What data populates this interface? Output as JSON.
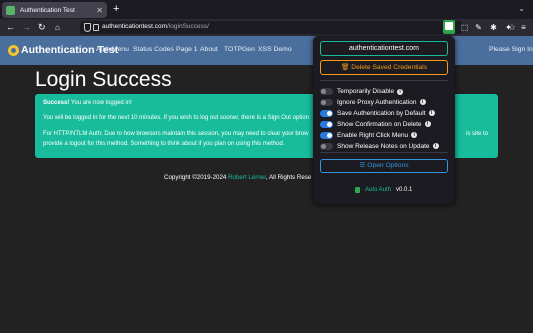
{
  "browser": {
    "tab_title": "Authentication Test",
    "new_tab_glyph": "+",
    "url_host": "authenticationtest.com",
    "url_path": "/loginSuccess/"
  },
  "site": {
    "brand": "Authentication Test",
    "nav": [
      "Auth Menu",
      "Status Codes",
      "Page 1",
      "About",
      "TOTPGen",
      "XSS Demo"
    ],
    "sign_in": "Please Sign In",
    "heading": "Login Success",
    "alert": {
      "bold": "Success!",
      "line1": " You are now logged in!",
      "line2": "You will be logged in for the next 10 minutes. If you wish to log out sooner, there is a Sign Out option",
      "line3": "For HTTP/NTLM Auth: Due to how browsers maintain this session, you may need to clear your brow",
      "line3_tail": "is site to",
      "line4": "provide a logout for this method. Something to think about if you plan on using this method."
    },
    "copyright_prefix": "Copyright ©2019-2024 ",
    "copyright_author": "Robert Lerner",
    "copyright_suffix": ", All Rights Rese"
  },
  "popup": {
    "domain": "authenticationtest.com",
    "delete_label": "Delete Saved Credentials",
    "toggles": [
      {
        "label": "Temporarily Disable",
        "on": false
      },
      {
        "label": "Ignore Proxy Authentication",
        "on": false
      },
      {
        "label": "Save Authentication by Default",
        "on": true
      },
      {
        "label": "Show Confirmation on Delete",
        "on": true
      },
      {
        "label": "Enable Right Click Menu",
        "on": true
      },
      {
        "label": "Show Release Notes on Update",
        "on": false
      }
    ],
    "options_label": "Open Options",
    "app_name": "Auto Auth",
    "version": "v0.0.1"
  },
  "colors": {
    "accent_green": "#18bc9c",
    "warning": "#f39c12",
    "info_blue": "#3498db",
    "navbar": "#4b6f9d"
  }
}
